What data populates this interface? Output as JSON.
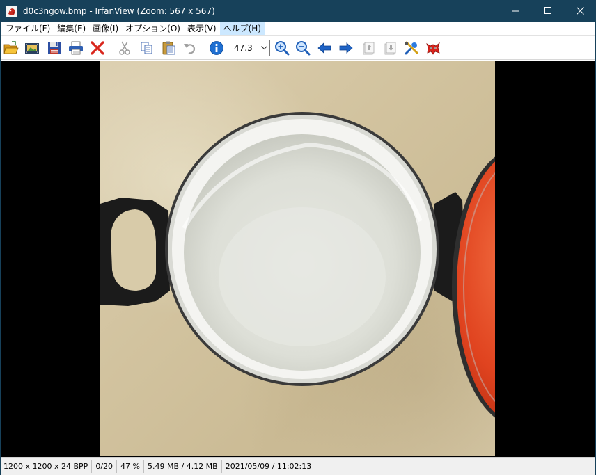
{
  "window": {
    "title": "d0c3ngow.bmp - IrfanView (Zoom: 567 x 567)"
  },
  "menu": {
    "items": [
      "ファイル(F)",
      "編集(E)",
      "画像(I)",
      "オプション(O)",
      "表示(V)",
      "ヘルプ(H)"
    ]
  },
  "toolbar": {
    "zoom_value": "47.3"
  },
  "status": {
    "dimensions": "1200 x 1200 x 24 BPP",
    "file_index": "0/20",
    "zoom_percent": "47 %",
    "memory": "5.49 MB / 4.12 MB",
    "datetime": "2021/05/09 / 11:02:13"
  },
  "colors": {
    "titlebar": "#17415a",
    "menu_highlight": "#cce8ff",
    "viewport_bg": "#000000"
  }
}
